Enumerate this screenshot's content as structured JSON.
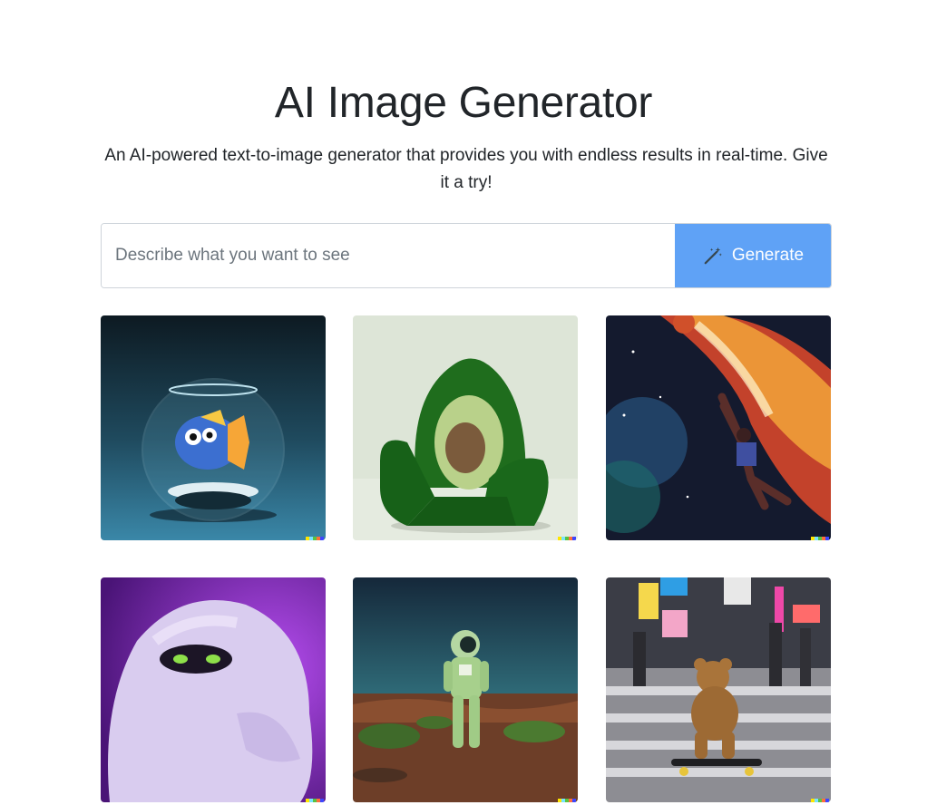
{
  "header": {
    "title": "AI Image Generator",
    "subtitle": "An AI-powered text-to-image generator that provides you with endless results in real-time. Give it a try!"
  },
  "search": {
    "placeholder": "Describe what you want to see",
    "value": "",
    "button_label": "Generate",
    "button_icon": "magic-wand-icon"
  },
  "colors": {
    "accent": "#5fa2f6",
    "text": "#212529",
    "placeholder": "#6c757d",
    "border": "#ced4da"
  },
  "gallery": {
    "images": [
      {
        "subject": "fish-bowl"
      },
      {
        "subject": "avocado-chair"
      },
      {
        "subject": "basketball-player-space"
      },
      {
        "subject": "fluffy-monster"
      },
      {
        "subject": "astronaut-desert"
      },
      {
        "subject": "teddy-bear-skateboard"
      }
    ]
  }
}
